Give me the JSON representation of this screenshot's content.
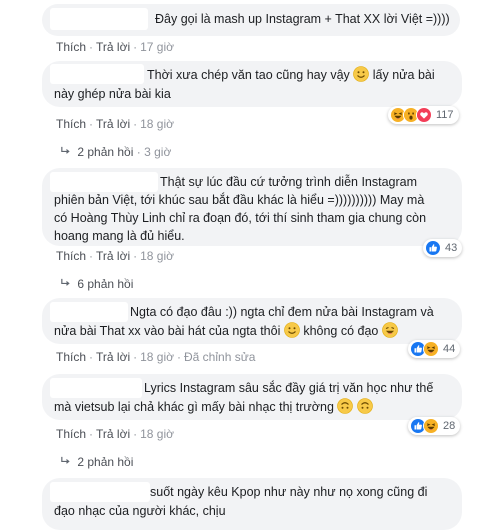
{
  "labels": {
    "like": "Thích",
    "reply": "Trả lời",
    "dot": "·",
    "edited": "Đã chỉnh sửa"
  },
  "comments": [
    {
      "text_a": "Đây gọi là mash up Instagram + That XX lời Việt =))))",
      "time": "17 giờ"
    },
    {
      "text_a": "Thời xưa chép văn tao cũng hay vậy",
      "text_b": "lấy nửa bài",
      "text_c": "này ghép nửa bài kia",
      "time": "18 giờ",
      "reactions": {
        "icons": [
          "haha-icon",
          "wow-icon",
          "love-icon"
        ],
        "count": "117"
      },
      "replies": {
        "label": "2 phản hồi",
        "time": "3 giờ"
      }
    },
    {
      "text_a": "Thật sự lúc đầu cứ tưởng trình diễn Instagram",
      "text_b": "phiên bản Việt, tới khúc sau bắt đầu khác là hiểu =)))))))))) May mà",
      "text_c": "có Hoàng Thùy Linh chỉ ra đoạn đó, tới thí sinh tham gia chung còn",
      "text_d": "hoang mang là đủ hiểu.",
      "time": "18 giờ",
      "reactions": {
        "icons": [
          "like-icon"
        ],
        "count": "43"
      },
      "replies": {
        "label": "6 phản hồi"
      }
    },
    {
      "text_a": "Ngta có đạo đâu :)) ngta chỉ đem nửa bài Instagram và",
      "text_b": "nửa bài That xx vào bài hát của ngta thôi",
      "text_c": "không có đạo",
      "time": "18 giờ",
      "reactions": {
        "icons": [
          "like-icon",
          "haha-icon"
        ],
        "count": "44"
      }
    },
    {
      "text_a": "Lyrics Instagram sâu sắc đầy giá trị văn học như thế",
      "text_b": "mà vietsub lại chả khác gì mấy bài nhạc thị trường",
      "time": "18 giờ",
      "reactions": {
        "icons": [
          "like-icon",
          "haha-icon"
        ],
        "count": "28"
      },
      "replies": {
        "label": "2 phản hồi"
      }
    },
    {
      "text_a": "suốt ngày kêu Kpop như này như nọ xong cũng đi",
      "text_b": "đạo nhạc của người khác, chịu"
    }
  ],
  "colors": {
    "bubble": "#f2f3f5",
    "like": "#1877f2",
    "love": "#f33e58",
    "haha": "#f7b125",
    "meta": "#90949c"
  }
}
